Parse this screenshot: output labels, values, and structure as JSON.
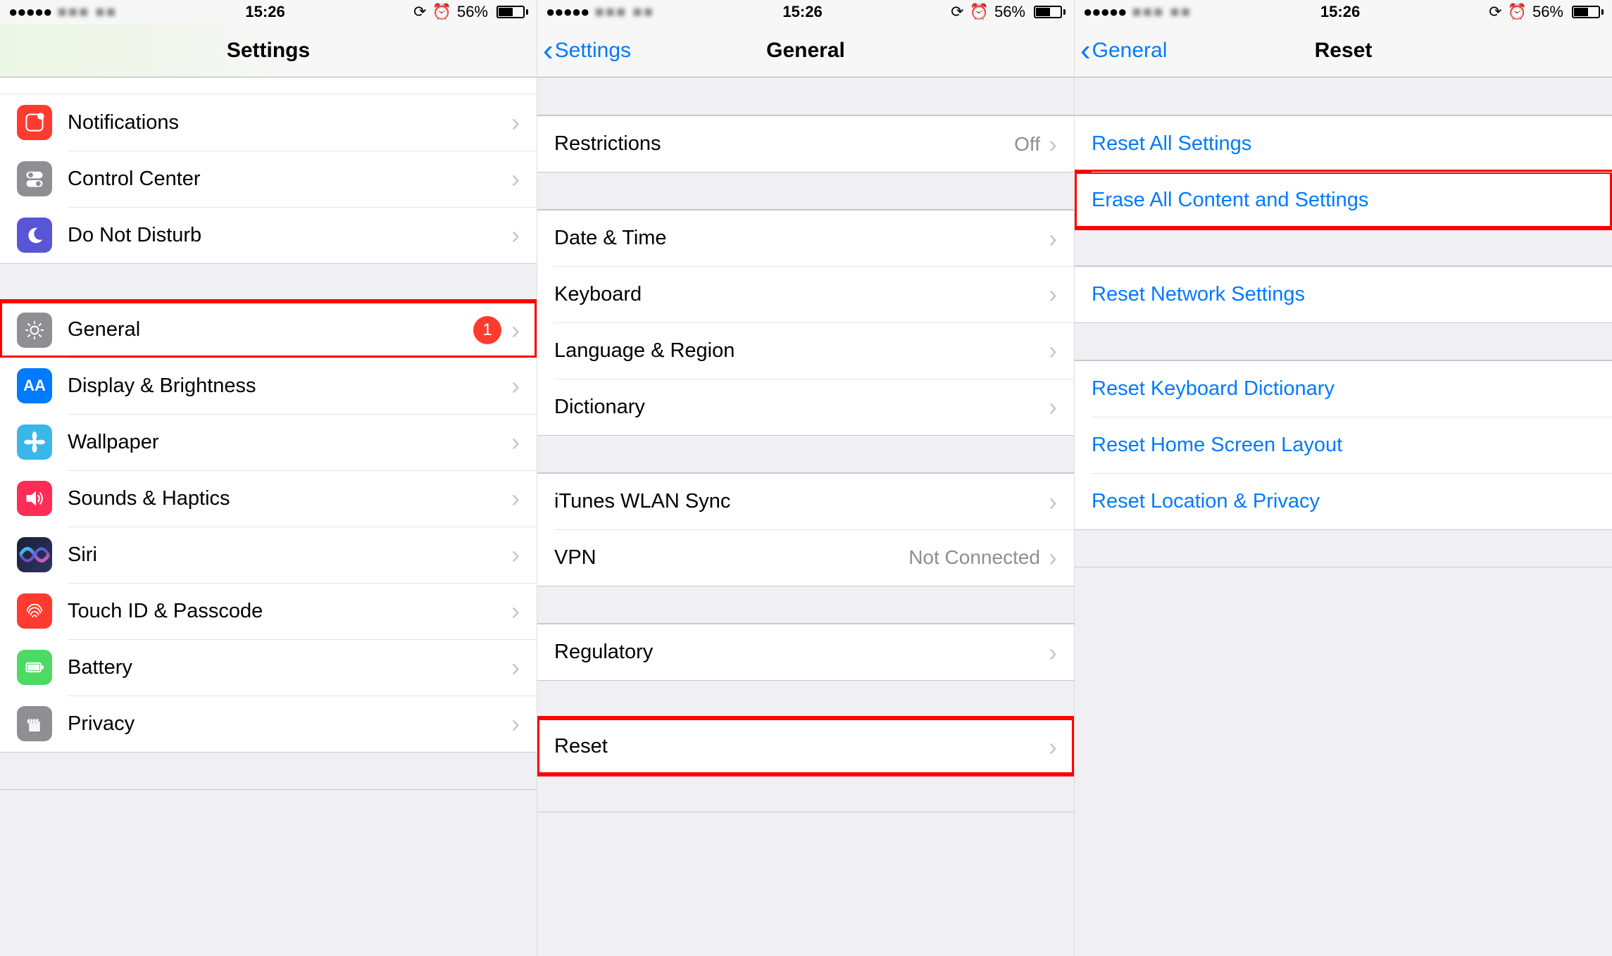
{
  "status": {
    "signal_glyph": "●●●●●",
    "carrier_blur": "■■■  ■■",
    "time": "15:26",
    "lock_glyph": "⟳",
    "alarm_glyph": "⏰",
    "battery_pct": "56%"
  },
  "screen1": {
    "title": "Settings",
    "groups": [
      {
        "partial_top": true,
        "items": [
          {
            "icon": "notifications",
            "label": "Notifications"
          },
          {
            "icon": "control",
            "label": "Control Center"
          },
          {
            "icon": "dnd",
            "label": "Do Not Disturb"
          }
        ]
      },
      {
        "items": [
          {
            "icon": "general",
            "label": "General",
            "badge": "1",
            "highlight": true
          },
          {
            "icon": "display",
            "label": "Display & Brightness"
          },
          {
            "icon": "wallpaper",
            "label": "Wallpaper"
          },
          {
            "icon": "sounds",
            "label": "Sounds & Haptics"
          },
          {
            "icon": "siri",
            "label": "Siri"
          },
          {
            "icon": "touchid",
            "label": "Touch ID & Passcode"
          },
          {
            "icon": "battery",
            "label": "Battery"
          },
          {
            "icon": "privacy",
            "label": "Privacy"
          }
        ]
      }
    ]
  },
  "screen2": {
    "back": "Settings",
    "title": "General",
    "groups": [
      {
        "items": [
          {
            "label": "Restrictions",
            "value": "Off"
          }
        ]
      },
      {
        "items": [
          {
            "label": "Date & Time"
          },
          {
            "label": "Keyboard"
          },
          {
            "label": "Language & Region"
          },
          {
            "label": "Dictionary"
          }
        ]
      },
      {
        "items": [
          {
            "label": "iTunes WLAN Sync"
          },
          {
            "label": "VPN",
            "value": "Not Connected"
          }
        ]
      },
      {
        "items": [
          {
            "label": "Regulatory"
          }
        ]
      },
      {
        "items": [
          {
            "label": "Reset",
            "highlight": true
          }
        ]
      }
    ]
  },
  "screen3": {
    "back": "General",
    "title": "Reset",
    "groups": [
      {
        "items": [
          {
            "label": "Reset All Settings",
            "blue": true
          },
          {
            "label": "Erase All Content and Settings",
            "blue": true,
            "highlight": true
          }
        ]
      },
      {
        "items": [
          {
            "label": "Reset Network Settings",
            "blue": true
          }
        ]
      },
      {
        "items": [
          {
            "label": "Reset Keyboard Dictionary",
            "blue": true
          },
          {
            "label": "Reset Home Screen Layout",
            "blue": true
          },
          {
            "label": "Reset Location & Privacy",
            "blue": true
          }
        ]
      }
    ]
  },
  "icons": {
    "notifications": "notifications-icon",
    "control": "control-center-icon",
    "dnd": "moon-icon",
    "general": "gear-icon",
    "display": "aa-icon",
    "wallpaper": "flower-icon",
    "sounds": "speaker-icon",
    "siri": "siri-icon",
    "touchid": "fingerprint-icon",
    "battery": "battery-icon",
    "privacy": "hand-icon"
  }
}
